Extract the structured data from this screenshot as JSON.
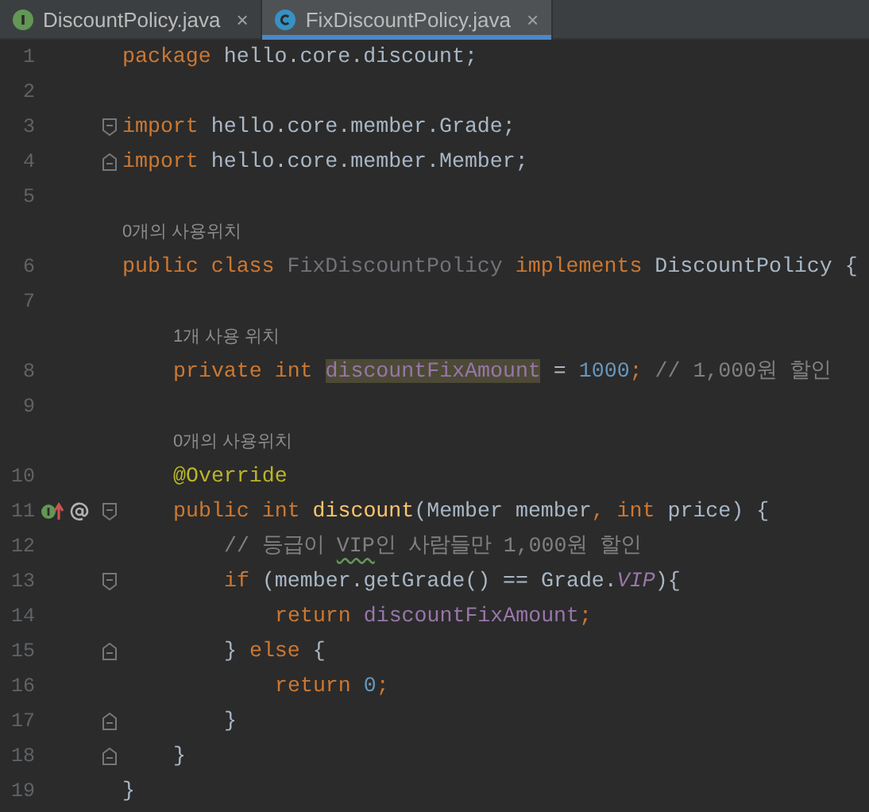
{
  "tabs": [
    {
      "label": "DiscountPolicy.java",
      "kind": "interface",
      "close": "×",
      "selected": false
    },
    {
      "label": "FixDiscountPolicy.java",
      "kind": "class",
      "close": "×",
      "selected": true
    }
  ],
  "lines": [
    {
      "kind": "code",
      "number": "1",
      "tokens": [
        {
          "text": "package ",
          "kind": "keyword"
        },
        {
          "text": "hello.core.discount;",
          "kind": "plain"
        }
      ]
    },
    {
      "kind": "code",
      "number": "2"
    },
    {
      "kind": "code",
      "number": "3",
      "fold_open": true,
      "tokens": [
        {
          "text": "import ",
          "kind": "keyword"
        },
        {
          "text": "hello.core.member.Grade;",
          "kind": "plain"
        }
      ]
    },
    {
      "kind": "code",
      "number": "4",
      "fold_close": true,
      "tokens": [
        {
          "text": "import ",
          "kind": "keyword"
        },
        {
          "text": "hello.core.member.Member;",
          "kind": "plain"
        }
      ]
    },
    {
      "kind": "code",
      "number": "5"
    },
    {
      "kind": "hint",
      "text": "0개의 사용위치"
    },
    {
      "kind": "code",
      "number": "6",
      "tokens": [
        {
          "text": "public class ",
          "kind": "keyword"
        },
        {
          "text": "FixDiscountPolicy ",
          "kind": "unused"
        },
        {
          "text": "implements ",
          "kind": "keyword"
        },
        {
          "text": "DiscountPolicy {",
          "kind": "plain"
        }
      ],
      "children": [
        {
          "kind": "code",
          "number": "7"
        },
        {
          "kind": "hint",
          "text": "1개 사용 위치"
        },
        {
          "kind": "code",
          "number": "8",
          "tokens": [
            {
              "text": "private int ",
              "kind": "keyword"
            },
            {
              "text": "discountFixAmount",
              "kind": "field",
              "highlighted": true
            },
            {
              "text": " = ",
              "kind": "plain"
            },
            {
              "text": "1000",
              "kind": "number"
            },
            {
              "text": "; ",
              "kind": "keyword"
            },
            {
              "text": "// 1,000원 할인",
              "kind": "comment"
            }
          ]
        },
        {
          "kind": "code",
          "number": "9"
        },
        {
          "kind": "hint",
          "text": "0개의 사용위치"
        },
        {
          "kind": "code",
          "number": "10",
          "tokens": [
            {
              "text": "@Override",
              "kind": "annotation"
            }
          ]
        },
        {
          "kind": "code",
          "number": "11",
          "overrides": true,
          "fold_open": true,
          "tokens": [
            {
              "text": "public int ",
              "kind": "keyword"
            },
            {
              "text": "discount",
              "kind": "method"
            },
            {
              "text": "(Member member",
              "kind": "plain"
            },
            {
              "text": ", int ",
              "kind": "keyword"
            },
            {
              "text": "price) {",
              "kind": "plain"
            }
          ],
          "children": [
            {
              "kind": "code",
              "number": "12",
              "tokens": [
                {
                  "text": "// 등급이 ",
                  "kind": "comment"
                },
                {
                  "text": "VIP",
                  "kind": "comment",
                  "typo": true
                },
                {
                  "text": "인 사람들만 1,000원 할인",
                  "kind": "comment"
                }
              ]
            },
            {
              "kind": "code",
              "number": "13",
              "fold_open": true,
              "tokens": [
                {
                  "text": "if ",
                  "kind": "keyword"
                },
                {
                  "text": "(member.getGrade() == Grade.",
                  "kind": "plain"
                },
                {
                  "text": "VIP",
                  "kind": "static"
                },
                {
                  "text": "){",
                  "kind": "plain"
                }
              ],
              "children": [
                {
                  "kind": "code",
                  "number": "14",
                  "tokens": [
                    {
                      "text": "return ",
                      "kind": "keyword"
                    },
                    {
                      "text": "discountFixAmount",
                      "kind": "field"
                    },
                    {
                      "text": ";",
                      "kind": "keyword"
                    }
                  ]
                }
              ]
            },
            {
              "kind": "code",
              "number": "15",
              "fold_close": true,
              "tokens": [
                {
                  "text": "} ",
                  "kind": "plain"
                },
                {
                  "text": "else ",
                  "kind": "keyword"
                },
                {
                  "text": "{",
                  "kind": "plain"
                }
              ],
              "children": [
                {
                  "kind": "code",
                  "number": "16",
                  "tokens": [
                    {
                      "text": "return ",
                      "kind": "keyword"
                    },
                    {
                      "text": "0",
                      "kind": "number"
                    },
                    {
                      "text": ";",
                      "kind": "keyword"
                    }
                  ]
                }
              ]
            },
            {
              "kind": "code",
              "number": "17",
              "fold_close": true,
              "tokens": [
                {
                  "text": "}",
                  "kind": "plain"
                }
              ]
            }
          ]
        },
        {
          "kind": "code",
          "number": "18",
          "fold_close": true,
          "tokens": [
            {
              "text": "}",
              "kind": "plain"
            }
          ]
        }
      ]
    },
    {
      "kind": "code",
      "number": "19",
      "tokens": [
        {
          "text": "}",
          "kind": "plain"
        }
      ]
    }
  ]
}
